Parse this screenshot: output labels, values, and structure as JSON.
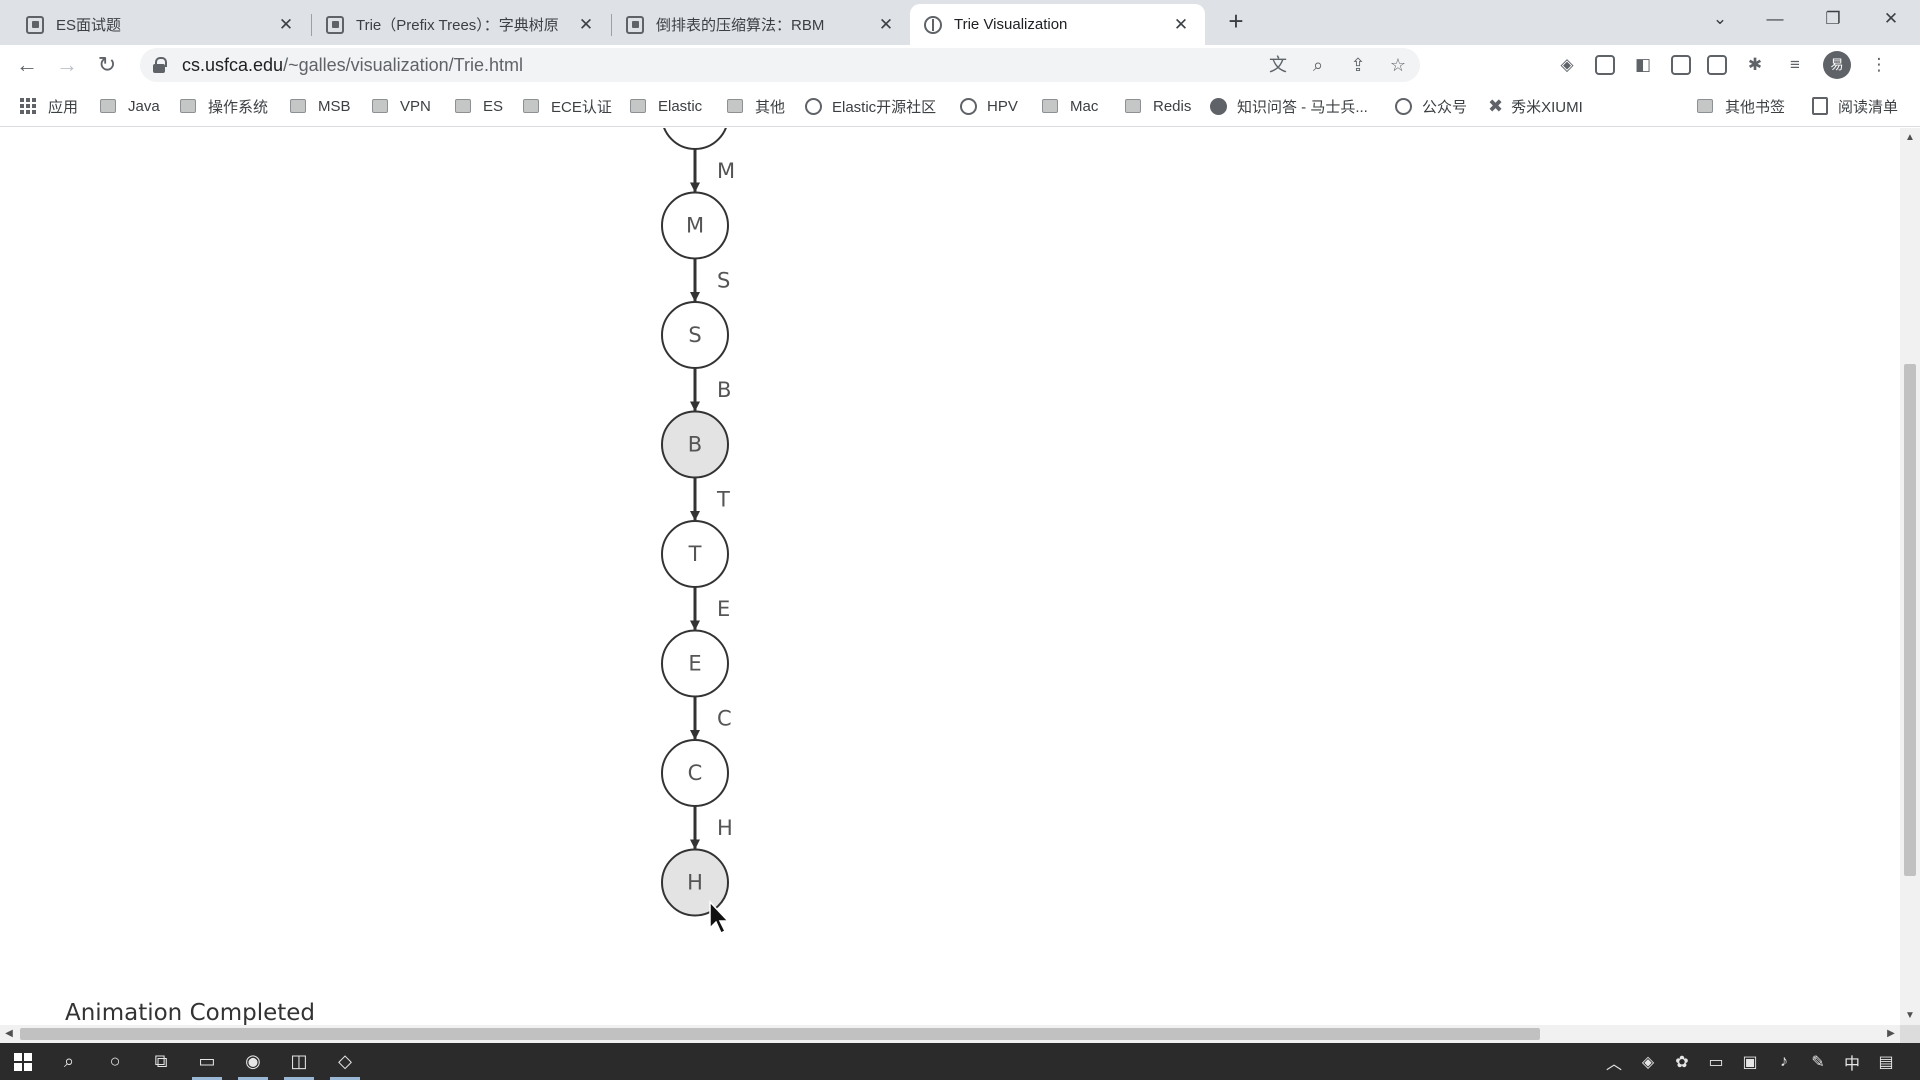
{
  "browser": {
    "tabs": [
      {
        "title": "ES面试题",
        "icon": "page-icon",
        "active": false
      },
      {
        "title": "Trie（Prefix Trees）：字典树原",
        "icon": "page-icon",
        "active": false
      },
      {
        "title": "倒排表的压缩算法：RBM",
        "icon": "page-icon",
        "active": false
      },
      {
        "title": "Trie Visualization",
        "icon": "globe-icon",
        "active": true
      }
    ],
    "new_tab_label": "+",
    "window_controls": {
      "minimize": "—",
      "restore": "❐",
      "close": "✕"
    },
    "nav": {
      "back": "←",
      "forward": "→",
      "reload": "↻"
    },
    "url_host": "cs.usfca.edu",
    "url_path": "/~galles/visualization/Trie.html",
    "profile_initial": "易"
  },
  "bookmarks": [
    {
      "label": "应用",
      "icon": "apps-grid-icon"
    },
    {
      "label": "Java",
      "icon": "folder-icon"
    },
    {
      "label": "操作系统",
      "icon": "folder-icon"
    },
    {
      "label": "MSB",
      "icon": "folder-icon"
    },
    {
      "label": "VPN",
      "icon": "folder-icon"
    },
    {
      "label": "ES",
      "icon": "folder-icon"
    },
    {
      "label": "ECE认证",
      "icon": "folder-icon"
    },
    {
      "label": "Elastic",
      "icon": "folder-icon"
    },
    {
      "label": "其他",
      "icon": "folder-icon"
    },
    {
      "label": "Elastic开源社区",
      "icon": "globe-icon"
    },
    {
      "label": "HPV",
      "icon": "globe-icon"
    },
    {
      "label": "Mac",
      "icon": "folder-icon"
    },
    {
      "label": "Redis",
      "icon": "folder-icon"
    },
    {
      "label": "知识问答 - 马士兵...",
      "icon": "site-icon"
    },
    {
      "label": "公众号",
      "icon": "spiral-icon"
    },
    {
      "label": "秀米XIUMI",
      "icon": "xiumi-icon"
    },
    {
      "label": "其他书签",
      "icon": "folder-icon"
    },
    {
      "label": "阅读清单",
      "icon": "reading-list-icon"
    }
  ],
  "trie": {
    "nodes": [
      {
        "label": "",
        "highlighted": false
      },
      {
        "label": "M",
        "highlighted": false
      },
      {
        "label": "S",
        "highlighted": false
      },
      {
        "label": "B",
        "highlighted": true
      },
      {
        "label": "T",
        "highlighted": false
      },
      {
        "label": "E",
        "highlighted": false
      },
      {
        "label": "C",
        "highlighted": false
      },
      {
        "label": "H",
        "highlighted": true
      }
    ],
    "edges": [
      "M",
      "S",
      "B",
      "T",
      "E",
      "C",
      "H"
    ],
    "node_fill": "#ffffff",
    "highlight_fill": "#e3e3e3",
    "stroke_color": "#333333",
    "edge_label_color": "#555555"
  },
  "status": "Animation Completed",
  "taskbar": {
    "apps": [
      "start",
      "search",
      "cortana",
      "task-view",
      "explorer",
      "chrome",
      "store",
      "vm"
    ],
    "tray_ime": "中"
  }
}
